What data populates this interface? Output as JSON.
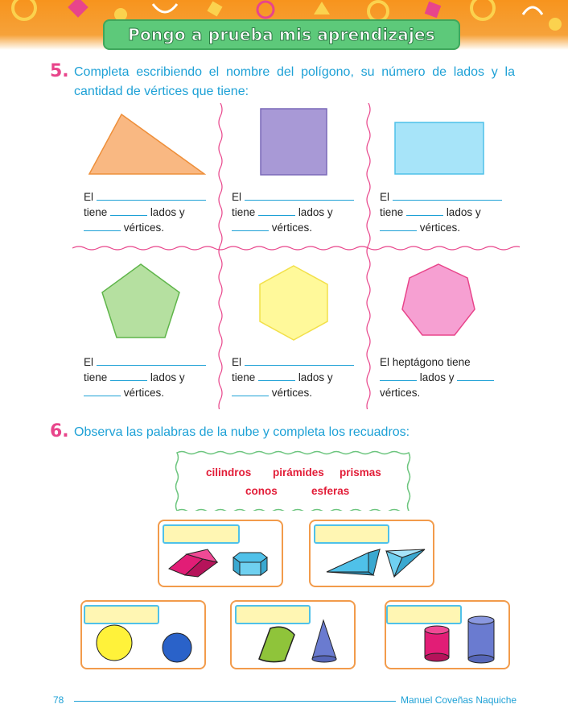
{
  "header": {
    "title": "Pongo a prueba mis aprendizajes"
  },
  "q5": {
    "number": "5.",
    "instruction_line1": "Completa escribiendo el nombre del polígono, su número de lados y la",
    "instruction_line2": "cantidad de vértices que tiene:",
    "word_el": "El",
    "word_tiene": "tiene",
    "word_lados": "lados y",
    "word_vertices": "vértices.",
    "last_line1": "El heptágono tiene",
    "last_line2": "lados y",
    "last_line3": "vértices."
  },
  "q6": {
    "number": "6.",
    "instruction": "Observa las palabras de la nube y completa los recuadros:",
    "cloud_words": [
      "cilindros",
      "pirámides",
      "prismas",
      "conos",
      "esferas"
    ]
  },
  "footer": {
    "page_number": "78",
    "author": "Manuel Coveñas Naquiche"
  },
  "colors": {
    "title_green": "#5dc97a",
    "question_blue": "#1ea1d6",
    "number_pink": "#e8458b",
    "cloud_red": "#e21d38",
    "box_orange": "#f29b4b"
  }
}
